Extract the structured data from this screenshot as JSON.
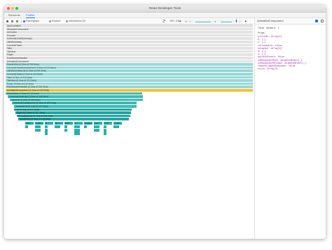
{
  "window": {
    "title": "React Developer Tools",
    "traffic_lights": [
      "#ff5f57",
      "#febc2e",
      "#28c840"
    ]
  },
  "tabs": [
    {
      "label": "Elements",
      "active": false
    },
    {
      "label": "Profiler",
      "active": true
    }
  ],
  "toolbar": {
    "flamegraph_label": "Flamegraph",
    "ranked_label": "Ranked",
    "interactions_label": "Interactions (0)",
    "commit_counter": "150 / 246"
  },
  "side_panel": {
    "title": "AnimatedComponent",
    "total_renders": "Total renders: 1",
    "props_header": "Props",
    "props_lines": [
      {
        "text": "children: Array[1]",
        "color": "#a020a0"
      },
      {
        "text": "  0: {…}",
        "color": "#a020a0"
      },
      {
        "text": "  1: {…}",
        "color": "#a020a0"
      },
      {
        "text": "collapsable: false",
        "color": "#a020a0"
      },
      {
        "text": "onLayout: Array[4]",
        "color": "#a020a0"
      },
      {
        "text": "  0: {…}",
        "color": "#a020a0"
      },
      {
        "text": "  1: {…}",
        "color": "#a020a0"
      },
      {
        "text": "pointerEvents: false",
        "color": "#a020a0"
      },
      {
        "text": "onResponderMove: AnimatedEvent{…}",
        "color": "#a020a0"
      },
      {
        "text": "onResponderRelease: AnimatedEvent{…}",
        "color": "#a020a0"
      },
      {
        "text": "removeClippedSubviews: false",
        "color": "#a020a0"
      },
      {
        "text": "style: Array[3]",
        "color": "#a020a0"
      }
    ]
  },
  "flame_rows": [
    {
      "label": "AppContainer",
      "kind": "gray"
    },
    {
      "label": "WrappedComponent",
      "kind": "gray"
    },
    {
      "label": "Unknown",
      "kind": "gray"
    },
    {
      "label": "Provider",
      "kind": "gray"
    },
    {
      "label": "Connect(JobsSummary)",
      "kind": "gray"
    },
    {
      "label": "JobsSummary",
      "kind": "gray"
    },
    {
      "label": "Connect(Tabs)",
      "kind": "gray"
    },
    {
      "label": "Tabs",
      "kind": "gray"
    },
    {
      "label": "TabView",
      "kind": "gray"
    },
    {
      "label": "Pager",
      "kind": "gray"
    },
    {
      "label": "PanGestureHandler",
      "kind": "gray"
    },
    {
      "label": "AnimatedComponent",
      "kind": "gray"
    },
    {
      "label": "SceneView (0.3ms of 224.9ms)",
      "kind": "light"
    },
    {
      "label": "Connect(JobsSummaryList) (0.3ms of 224.6ms)",
      "kind": "light"
    },
    {
      "label": "JobsSummaryList (0.4ms of 224.3ms)",
      "kind": "light"
    },
    {
      "label": "Connect(Tabs) (0.3ms of 213.9ms)",
      "kind": "light"
    },
    {
      "label": "Tabs (0.3ms of 213.6ms)",
      "kind": "light"
    },
    {
      "label": "TabView (0.4ms of 213.3ms)",
      "kind": "light"
    },
    {
      "label": "Pager (2.0ms of 212.9ms)",
      "kind": "light"
    },
    {
      "label": "PanGestureHandler (0.4ms of 210.9ms)",
      "kind": "light"
    },
    {
      "label": "AnimatedComponent (1.0ms of 210.5ms)",
      "kind": "sel"
    },
    {
      "label": "SceneView (0.3ms of 140.2ms)",
      "kind": "mid"
    },
    {
      "label": "Connect(JobsList) (0.3ms of 140.0ms)",
      "kind": "mid"
    },
    {
      "label": "JobsList (0.4ms of 139.6ms)",
      "kind": "mid"
    },
    {
      "label": "Connect(SortableList) (0.3ms of 125.0ms)",
      "kind": "mid"
    },
    {
      "label": "SortableList (0.4ms of 117.9ms)",
      "kind": "mid"
    },
    {
      "label": "List (0.4ms of 117.5ms)",
      "kind": "dark"
    },
    {
      "label": "FlatList (0.4ms of 117.1ms)",
      "kind": "dark"
    },
    {
      "label": "VirtualizedList (2.7ms of 116.7ms)",
      "kind": "dark"
    },
    {
      "label": "ScrollView (0.4ms of 113.9ms)",
      "kind": "dark"
    }
  ],
  "leaf_labels": [
    "Cell…",
    "CellR…",
    "C…",
    "Cel…",
    "Cell…",
    "C…",
    "CellRe…",
    "Cell…"
  ]
}
